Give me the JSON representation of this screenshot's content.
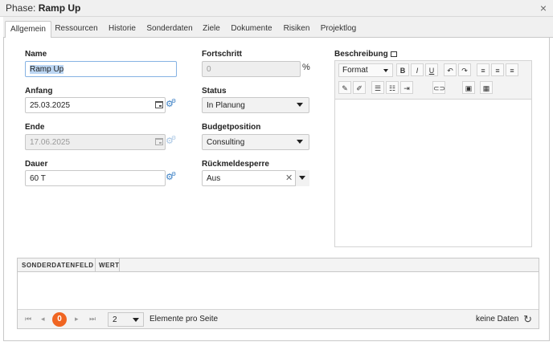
{
  "window": {
    "title_prefix": "Phase:",
    "title_name": "Ramp Up",
    "close_icon": "×"
  },
  "tabs": [
    {
      "label": "Allgemein",
      "active": true
    },
    {
      "label": "Ressourcen"
    },
    {
      "label": "Historie"
    },
    {
      "label": "Sonderdaten"
    },
    {
      "label": "Ziele"
    },
    {
      "label": "Dokumente"
    },
    {
      "label": "Risiken"
    },
    {
      "label": "Projektlog"
    }
  ],
  "form": {
    "name_label": "Name",
    "name_value": "Ramp Up",
    "anfang_label": "Anfang",
    "anfang_value": "25.03.2025",
    "ende_label": "Ende",
    "ende_value": "17.06.2025",
    "dauer_label": "Dauer",
    "dauer_value": "60 T",
    "fortschritt_label": "Fortschritt",
    "fortschritt_value": "0",
    "fortschritt_unit": "%",
    "status_label": "Status",
    "status_value": "In Planung",
    "budget_label": "Budgetposition",
    "budget_value": "Consulting",
    "rueck_label": "Rückmeldesperre",
    "rueck_value": "Aus",
    "beschreibung_label": "Beschreibung"
  },
  "editor": {
    "format_label": "Format",
    "bold": "B",
    "italic": "I",
    "underline": "U",
    "undo": "↶",
    "redo": "↷"
  },
  "grid": {
    "col1": "SONDERDATENFELD",
    "col2": "WERT",
    "pager": {
      "current_page": "0",
      "page_size": "2",
      "per_page_label": "Elemente pro Seite",
      "status": "keine Daten"
    }
  },
  "colors": {
    "accent": "#f06522",
    "gear": "#3a7fc4",
    "selection": "#bcd6f3"
  }
}
